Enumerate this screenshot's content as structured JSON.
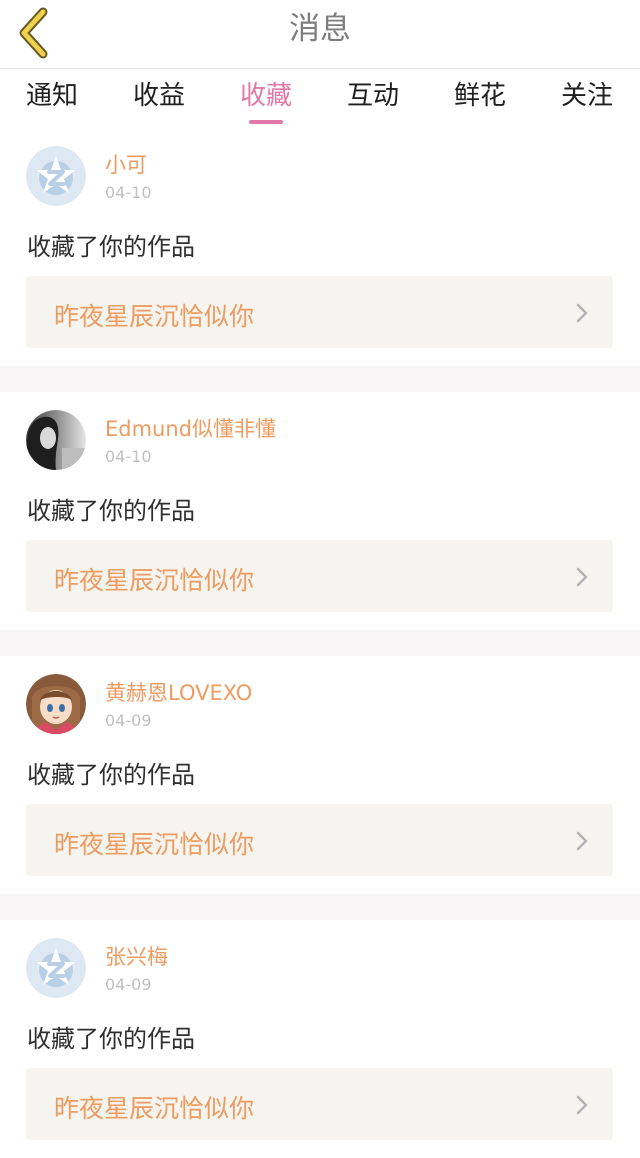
{
  "header": {
    "title": "消息",
    "back_icon": "chevron-left-icon"
  },
  "tabs": [
    {
      "label": "通知",
      "active": false
    },
    {
      "label": "收益",
      "active": false
    },
    {
      "label": "收藏",
      "active": true
    },
    {
      "label": "互动",
      "active": false
    },
    {
      "label": "鲜花",
      "active": false
    },
    {
      "label": "关注",
      "active": false
    }
  ],
  "items": [
    {
      "user": "小可",
      "date": "04-10",
      "action": "收藏了你的作品",
      "work": "昨夜星辰沉恰似你",
      "avatar": "default-qzone-avatar"
    },
    {
      "user": "Edmund似懂非懂",
      "date": "04-10",
      "action": "收藏了你的作品",
      "work": "昨夜星辰沉恰似你",
      "avatar": "photo-avatar"
    },
    {
      "user": "黄赫恩LOVEXO",
      "date": "04-09",
      "action": "收藏了你的作品",
      "work": "昨夜星辰沉恰似你",
      "avatar": "anime-avatar"
    },
    {
      "user": "张兴梅",
      "date": "04-09",
      "action": "收藏了你的作品",
      "work": "昨夜星辰沉恰似你",
      "avatar": "default-qzone-avatar"
    }
  ],
  "colors": {
    "accent": "#e079a9",
    "username": "#ef9a5e",
    "back_icon": "#e7c94a"
  }
}
